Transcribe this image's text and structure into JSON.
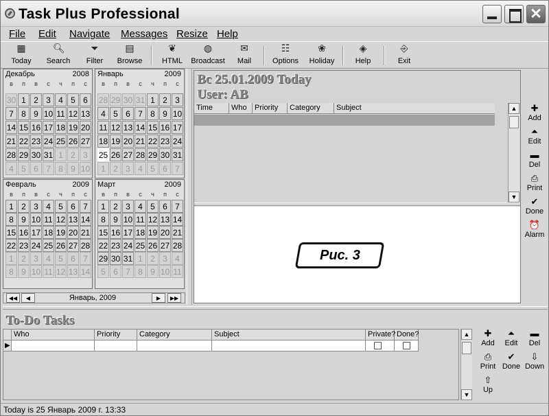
{
  "window": {
    "title": "Task Plus Professional",
    "close_glyph": "✕"
  },
  "menu": [
    "File",
    "Edit",
    "Navigate",
    "Messages",
    "Resize",
    "Help"
  ],
  "toolbar": [
    {
      "label": "Today",
      "icon": "calendar-icon"
    },
    {
      "label": "Search",
      "icon": "magnifier-icon"
    },
    {
      "label": "Filter",
      "icon": "funnel-icon"
    },
    {
      "label": "Browse",
      "icon": "table-icon"
    },
    {
      "label": "HTML",
      "icon": "html-icon"
    },
    {
      "label": "Broadcast",
      "icon": "broadcast-icon"
    },
    {
      "label": "Mail",
      "icon": "mail-icon"
    },
    {
      "label": "Options",
      "icon": "options-icon"
    },
    {
      "label": "Holiday",
      "icon": "holiday-icon"
    },
    {
      "label": "Help",
      "icon": "help-book-icon"
    },
    {
      "label": "Exit",
      "icon": "exit-icon"
    }
  ],
  "calendars": [
    {
      "month": "Декабрь",
      "year": "2008",
      "dow": [
        "в",
        "п",
        "в",
        "с",
        "ч",
        "п",
        "с"
      ],
      "weeks": [
        [
          "30",
          "1",
          "2",
          "3",
          "4",
          "5",
          "6"
        ],
        [
          "7",
          "8",
          "9",
          "10",
          "11",
          "12",
          "13"
        ],
        [
          "14",
          "15",
          "16",
          "17",
          "18",
          "19",
          "20"
        ],
        [
          "21",
          "22",
          "23",
          "24",
          "25",
          "26",
          "27"
        ],
        [
          "28",
          "29",
          "30",
          "31",
          "1",
          "2",
          "3"
        ],
        [
          "4",
          "5",
          "6",
          "7",
          "8",
          "9",
          "10"
        ]
      ],
      "first_in": 1,
      "last_in": 31
    },
    {
      "month": "Январь",
      "year": "2009",
      "dow": [
        "в",
        "п",
        "в",
        "с",
        "ч",
        "п",
        "с"
      ],
      "weeks": [
        [
          "28",
          "29",
          "30",
          "31",
          "1",
          "2",
          "3"
        ],
        [
          "4",
          "5",
          "6",
          "7",
          "8",
          "9",
          "10"
        ],
        [
          "11",
          "12",
          "13",
          "14",
          "15",
          "16",
          "17"
        ],
        [
          "18",
          "19",
          "20",
          "21",
          "22",
          "23",
          "24"
        ],
        [
          "25",
          "26",
          "27",
          "28",
          "29",
          "30",
          "31"
        ],
        [
          "1",
          "2",
          "3",
          "4",
          "5",
          "6",
          "7"
        ]
      ],
      "first_in": 4,
      "last_in": 34,
      "today": "25"
    },
    {
      "month": "Февраль",
      "year": "2009",
      "dow": [
        "в",
        "п",
        "в",
        "с",
        "ч",
        "п",
        "с"
      ],
      "weeks": [
        [
          "",
          "",
          "",
          "",
          "",
          "",
          ""
        ],
        [
          "1",
          "2",
          "3",
          "4",
          "5",
          "6",
          "7"
        ],
        [
          "8",
          "9",
          "10",
          "11",
          "12",
          "13",
          "14"
        ],
        [
          "15",
          "16",
          "17",
          "18",
          "19",
          "20",
          "21"
        ],
        [
          "22",
          "23",
          "24",
          "25",
          "26",
          "27",
          "28"
        ],
        [
          "1",
          "2",
          "3",
          "4",
          "5",
          "6",
          "7"
        ],
        [
          "8",
          "9",
          "10",
          "11",
          "12",
          "13",
          "14"
        ]
      ],
      "first_in": 7,
      "last_in": 34
    },
    {
      "month": "Март",
      "year": "2009",
      "dow": [
        "в",
        "п",
        "в",
        "с",
        "ч",
        "п",
        "с"
      ],
      "weeks": [
        [
          "",
          "",
          "",
          "",
          "",
          "",
          ""
        ],
        [
          "1",
          "2",
          "3",
          "4",
          "5",
          "6",
          "7"
        ],
        [
          "8",
          "9",
          "10",
          "11",
          "12",
          "13",
          "14"
        ],
        [
          "15",
          "16",
          "17",
          "18",
          "19",
          "20",
          "21"
        ],
        [
          "22",
          "23",
          "24",
          "25",
          "26",
          "27",
          "28"
        ],
        [
          "29",
          "30",
          "31",
          "1",
          "2",
          "3",
          "4"
        ],
        [
          "5",
          "6",
          "7",
          "8",
          "9",
          "10",
          "11"
        ]
      ],
      "first_in": 7,
      "last_in": 37
    }
  ],
  "calnav": {
    "label": "Январь, 2009",
    "first": "◀◀",
    "prev": "◀",
    "next": "▶",
    "last": "▶▶"
  },
  "day": {
    "date_line": "Вс 25.01.2009  Today",
    "user_line": "User: AB",
    "columns": [
      "Time",
      "Who",
      "Priority",
      "Category",
      "Subject"
    ],
    "figure_label": "Рис. 3"
  },
  "day_buttons": [
    {
      "label": "Add",
      "glyph": "✚"
    },
    {
      "label": "Edit",
      "glyph": "⏶"
    },
    {
      "label": "Del",
      "glyph": "▬"
    },
    {
      "label": "Print",
      "glyph": "⎙"
    },
    {
      "label": "Done",
      "glyph": "✔"
    },
    {
      "label": "Alarm",
      "glyph": "⏰"
    }
  ],
  "todo": {
    "title": "To-Do Tasks",
    "columns": [
      "Who",
      "Priority",
      "Category",
      "Subject",
      "Private?",
      "Done?"
    ],
    "row_marker": "▶"
  },
  "todo_buttons": [
    {
      "label": "Add",
      "glyph": "✚"
    },
    {
      "label": "Edit",
      "glyph": "⏶"
    },
    {
      "label": "Del",
      "glyph": "▬"
    },
    {
      "label": "Print",
      "glyph": "⎙"
    },
    {
      "label": "Done",
      "glyph": "✔"
    },
    {
      "label": "Down",
      "glyph": "⇩"
    },
    {
      "label": "Up",
      "glyph": "⇧"
    }
  ],
  "scroll": {
    "up": "▲",
    "down": "▼"
  },
  "status": "Today is 25 Январь 2009 г. 13:33"
}
